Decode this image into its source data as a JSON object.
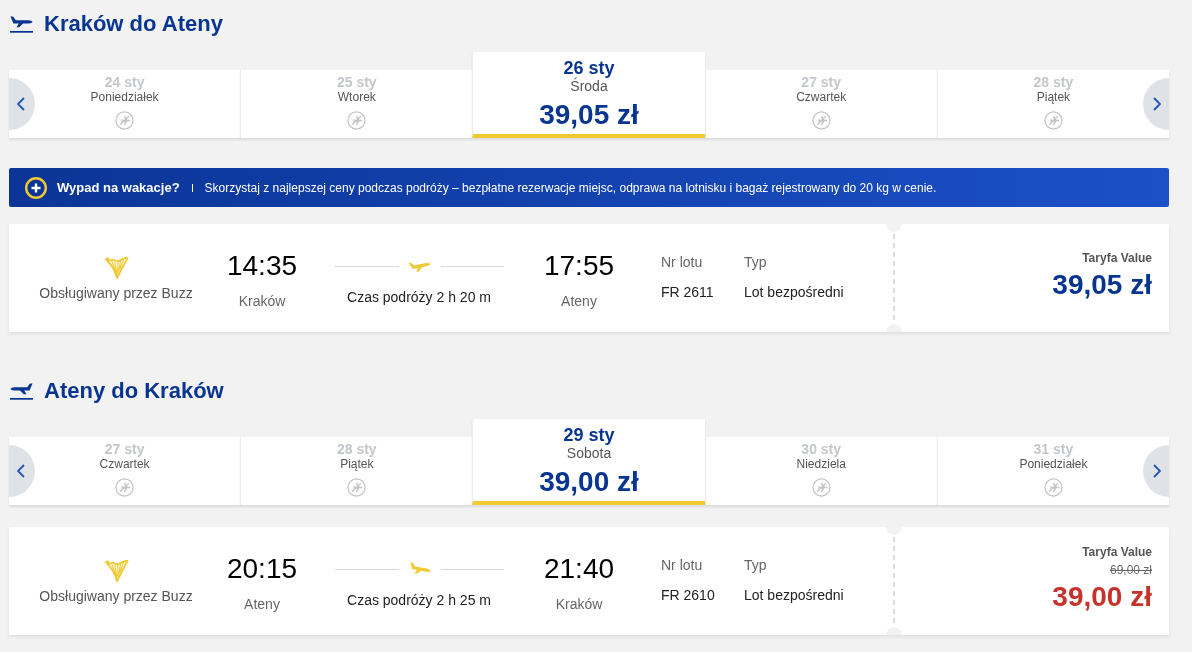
{
  "sections": [
    {
      "kind": "outbound",
      "title": "Kraków do Ateny",
      "dates": [
        {
          "date": "24 sty",
          "day": "Poniedziałek",
          "selected": false
        },
        {
          "date": "25 sty",
          "day": "Wtorek",
          "selected": false
        },
        {
          "date": "26 sty",
          "day": "Środa",
          "price": "39,05 zł",
          "selected": true
        },
        {
          "date": "27 sty",
          "day": "Czwartek",
          "selected": false
        },
        {
          "date": "28 sty",
          "day": "Piątek",
          "selected": false
        }
      ],
      "banner": {
        "title": "Wypad na wakacje?",
        "text": "Skorzystaj z najlepszej ceny podczas podróży – bezpłatne rezerwacje miejsc, odprawa na lotnisku i bagaż rejestrowany do 20 kg w cenie."
      },
      "flight": {
        "operator": "Obsługiwany przez Buzz",
        "departure_time": "14:35",
        "departure_city": "Kraków",
        "duration": "Czas podróży 2 h 20 m",
        "arrival_time": "17:55",
        "arrival_city": "Ateny",
        "flight_number_label": "Nr lotu",
        "flight_number": "FR 2611",
        "type_label": "Typ",
        "type": "Lot bezpośredni",
        "fare": "Taryfa Value",
        "price": "39,05 zł"
      }
    },
    {
      "kind": "inbound",
      "title": "Ateny do Kraków",
      "dates": [
        {
          "date": "27 sty",
          "day": "Czwartek",
          "selected": false
        },
        {
          "date": "28 sty",
          "day": "Piątek",
          "selected": false
        },
        {
          "date": "29 sty",
          "day": "Sobota",
          "price": "39,00 zł",
          "selected": true
        },
        {
          "date": "30 sty",
          "day": "Niedziela",
          "selected": false
        },
        {
          "date": "31 sty",
          "day": "Poniedziałek",
          "selected": false
        }
      ],
      "flight": {
        "operator": "Obsługiwany przez Buzz",
        "departure_time": "20:15",
        "departure_city": "Ateny",
        "duration": "Czas podróży 2 h 25 m",
        "arrival_time": "21:40",
        "arrival_city": "Kraków",
        "flight_number_label": "Nr lotu",
        "flight_number": "FR 2610",
        "type_label": "Typ",
        "type": "Lot bezpośredni",
        "fare": "Taryfa Value",
        "old_price": "69,00 zł",
        "price": "39,00 zł"
      }
    }
  ]
}
